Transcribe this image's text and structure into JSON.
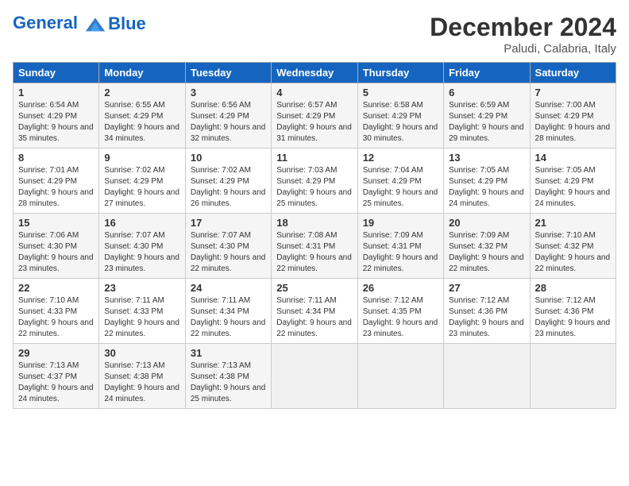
{
  "header": {
    "logo_line1": "General",
    "logo_line2": "Blue",
    "month": "December 2024",
    "location": "Paludi, Calabria, Italy"
  },
  "days_of_week": [
    "Sunday",
    "Monday",
    "Tuesday",
    "Wednesday",
    "Thursday",
    "Friday",
    "Saturday"
  ],
  "weeks": [
    [
      {
        "day": "1",
        "sunrise": "6:54 AM",
        "sunset": "4:29 PM",
        "daylight": "9 hours and 35 minutes."
      },
      {
        "day": "2",
        "sunrise": "6:55 AM",
        "sunset": "4:29 PM",
        "daylight": "9 hours and 34 minutes."
      },
      {
        "day": "3",
        "sunrise": "6:56 AM",
        "sunset": "4:29 PM",
        "daylight": "9 hours and 32 minutes."
      },
      {
        "day": "4",
        "sunrise": "6:57 AM",
        "sunset": "4:29 PM",
        "daylight": "9 hours and 31 minutes."
      },
      {
        "day": "5",
        "sunrise": "6:58 AM",
        "sunset": "4:29 PM",
        "daylight": "9 hours and 30 minutes."
      },
      {
        "day": "6",
        "sunrise": "6:59 AM",
        "sunset": "4:29 PM",
        "daylight": "9 hours and 29 minutes."
      },
      {
        "day": "7",
        "sunrise": "7:00 AM",
        "sunset": "4:29 PM",
        "daylight": "9 hours and 28 minutes."
      }
    ],
    [
      {
        "day": "8",
        "sunrise": "7:01 AM",
        "sunset": "4:29 PM",
        "daylight": "9 hours and 28 minutes."
      },
      {
        "day": "9",
        "sunrise": "7:02 AM",
        "sunset": "4:29 PM",
        "daylight": "9 hours and 27 minutes."
      },
      {
        "day": "10",
        "sunrise": "7:02 AM",
        "sunset": "4:29 PM",
        "daylight": "9 hours and 26 minutes."
      },
      {
        "day": "11",
        "sunrise": "7:03 AM",
        "sunset": "4:29 PM",
        "daylight": "9 hours and 25 minutes."
      },
      {
        "day": "12",
        "sunrise": "7:04 AM",
        "sunset": "4:29 PM",
        "daylight": "9 hours and 25 minutes."
      },
      {
        "day": "13",
        "sunrise": "7:05 AM",
        "sunset": "4:29 PM",
        "daylight": "9 hours and 24 minutes."
      },
      {
        "day": "14",
        "sunrise": "7:05 AM",
        "sunset": "4:29 PM",
        "daylight": "9 hours and 24 minutes."
      }
    ],
    [
      {
        "day": "15",
        "sunrise": "7:06 AM",
        "sunset": "4:30 PM",
        "daylight": "9 hours and 23 minutes."
      },
      {
        "day": "16",
        "sunrise": "7:07 AM",
        "sunset": "4:30 PM",
        "daylight": "9 hours and 23 minutes."
      },
      {
        "day": "17",
        "sunrise": "7:07 AM",
        "sunset": "4:30 PM",
        "daylight": "9 hours and 22 minutes."
      },
      {
        "day": "18",
        "sunrise": "7:08 AM",
        "sunset": "4:31 PM",
        "daylight": "9 hours and 22 minutes."
      },
      {
        "day": "19",
        "sunrise": "7:09 AM",
        "sunset": "4:31 PM",
        "daylight": "9 hours and 22 minutes."
      },
      {
        "day": "20",
        "sunrise": "7:09 AM",
        "sunset": "4:32 PM",
        "daylight": "9 hours and 22 minutes."
      },
      {
        "day": "21",
        "sunrise": "7:10 AM",
        "sunset": "4:32 PM",
        "daylight": "9 hours and 22 minutes."
      }
    ],
    [
      {
        "day": "22",
        "sunrise": "7:10 AM",
        "sunset": "4:33 PM",
        "daylight": "9 hours and 22 minutes."
      },
      {
        "day": "23",
        "sunrise": "7:11 AM",
        "sunset": "4:33 PM",
        "daylight": "9 hours and 22 minutes."
      },
      {
        "day": "24",
        "sunrise": "7:11 AM",
        "sunset": "4:34 PM",
        "daylight": "9 hours and 22 minutes."
      },
      {
        "day": "25",
        "sunrise": "7:11 AM",
        "sunset": "4:34 PM",
        "daylight": "9 hours and 22 minutes."
      },
      {
        "day": "26",
        "sunrise": "7:12 AM",
        "sunset": "4:35 PM",
        "daylight": "9 hours and 23 minutes."
      },
      {
        "day": "27",
        "sunrise": "7:12 AM",
        "sunset": "4:36 PM",
        "daylight": "9 hours and 23 minutes."
      },
      {
        "day": "28",
        "sunrise": "7:12 AM",
        "sunset": "4:36 PM",
        "daylight": "9 hours and 23 minutes."
      }
    ],
    [
      {
        "day": "29",
        "sunrise": "7:13 AM",
        "sunset": "4:37 PM",
        "daylight": "9 hours and 24 minutes."
      },
      {
        "day": "30",
        "sunrise": "7:13 AM",
        "sunset": "4:38 PM",
        "daylight": "9 hours and 24 minutes."
      },
      {
        "day": "31",
        "sunrise": "7:13 AM",
        "sunset": "4:38 PM",
        "daylight": "9 hours and 25 minutes."
      },
      null,
      null,
      null,
      null
    ]
  ],
  "labels": {
    "sunrise_prefix": "Sunrise: ",
    "sunset_prefix": "Sunset: ",
    "daylight_prefix": "Daylight: "
  }
}
